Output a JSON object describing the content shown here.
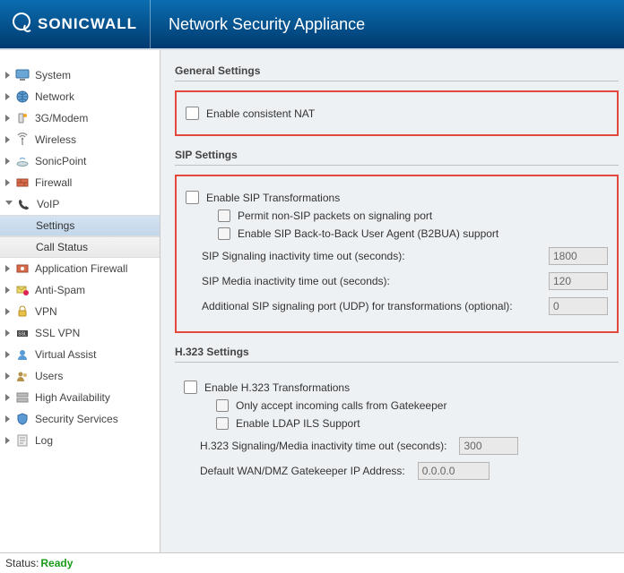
{
  "header": {
    "brand": "SONICWALL",
    "app": "Network Security Appliance"
  },
  "sidebar": {
    "items": [
      {
        "label": "System"
      },
      {
        "label": "Network"
      },
      {
        "label": "3G/Modem"
      },
      {
        "label": "Wireless"
      },
      {
        "label": "SonicPoint"
      },
      {
        "label": "Firewall"
      },
      {
        "label": "VoIP"
      },
      {
        "label": "Application Firewall"
      },
      {
        "label": "Anti-Spam"
      },
      {
        "label": "VPN"
      },
      {
        "label": "SSL VPN"
      },
      {
        "label": "Virtual Assist"
      },
      {
        "label": "Users"
      },
      {
        "label": "High Availability"
      },
      {
        "label": "Security Services"
      },
      {
        "label": "Log"
      }
    ],
    "voip_sub": [
      {
        "label": "Settings"
      },
      {
        "label": "Call Status"
      }
    ]
  },
  "general": {
    "title": "General Settings",
    "enable_consistent_nat": "Enable consistent NAT"
  },
  "sip": {
    "title": "SIP Settings",
    "enable_transform": "Enable SIP Transformations",
    "permit_non_sip": "Permit non-SIP packets on signaling port",
    "enable_b2bua": "Enable SIP Back-to-Back User Agent (B2BUA) support",
    "sig_timeout_label": "SIP Signaling inactivity time out (seconds):",
    "sig_timeout_value": "1800",
    "media_timeout_label": "SIP Media inactivity time out (seconds):",
    "media_timeout_value": "120",
    "addl_port_label": "Additional SIP signaling port (UDP) for transformations (optional):",
    "addl_port_value": "0"
  },
  "h323": {
    "title": "H.323 Settings",
    "enable_transform": "Enable H.323 Transformations",
    "only_gatekeeper": "Only accept incoming calls from Gatekeeper",
    "enable_ldap": "Enable LDAP ILS Support",
    "sig_timeout_label": "H.323 Signaling/Media inactivity time out (seconds):",
    "sig_timeout_value": "300",
    "gatekeeper_label": "Default WAN/DMZ Gatekeeper IP Address:",
    "gatekeeper_value": "0.0.0.0"
  },
  "status": {
    "label": "Status:",
    "value": "Ready"
  }
}
